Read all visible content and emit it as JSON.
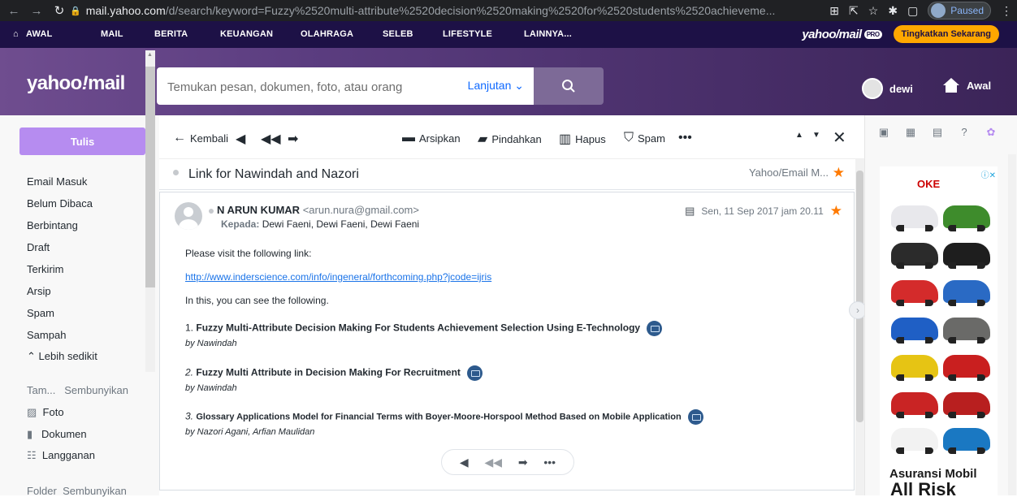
{
  "browser": {
    "url_host": "mail.yahoo.com",
    "url_path": "/d/search/keyword=Fuzzy%2520multi-attribute%2520decision%2520making%2520for%2520students%2520achieveme...",
    "paused_label": "Paused"
  },
  "topnav": {
    "items": [
      "AWAL",
      "MAIL",
      "BERITA",
      "KEUANGAN",
      "OLAHRAGA",
      "SELEB",
      "LIFESTYLE",
      "LAINNYA..."
    ],
    "logo": "yahoo/mail",
    "pro": "PRO",
    "upgrade_label": "Tingkatkan Sekarang"
  },
  "header": {
    "logo_text": "yahoo",
    "logo_bang": "!",
    "logo_mail": "mail",
    "search_placeholder": "Temukan pesan, dokumen, foto, atau orang",
    "advanced_label": "Lanjutan",
    "user_name": "dewi",
    "home_label": "Awal"
  },
  "sidebar": {
    "compose_label": "Tulis",
    "folders": [
      "Email Masuk",
      "Belum Dibaca",
      "Berbintang",
      "Draft",
      "Terkirim",
      "Arsip",
      "Spam",
      "Sampah"
    ],
    "less_label": "Lebih sedikit",
    "views_label": "Tam...",
    "views_hide": "Sembunyikan",
    "views": [
      "Foto",
      "Dokumen",
      "Langganan"
    ],
    "folders_label": "Folder",
    "folders_hide": "Sembunyikan"
  },
  "toolbar": {
    "back": "Kembali",
    "archive": "Arsipkan",
    "move": "Pindahkan",
    "delete": "Hapus",
    "spam": "Spam"
  },
  "email": {
    "subject": "Link for Nawindah and Nazori",
    "folder_label": "Yahoo/Email M...",
    "sender_name": "N ARUN KUMAR",
    "sender_email": "<arun.nura@gmail.com>",
    "to_label": "Kepada:",
    "recipients": "Dewi Faeni,  Dewi Faeni,  Dewi Faeni",
    "date": "Sen, 11 Sep 2017 jam 20.11",
    "line1": "Please visit the following link:",
    "link": "http://www.inderscience.com/info/ingeneral/forthcoming.php?jcode=ijris",
    "line2": "In this, you can see the following.",
    "items": [
      {
        "num": "1.",
        "title": "Fuzzy Multi-Attribute Decision Making For Students Achievement Selection Using E-Technology",
        "by": "by Nawindah"
      },
      {
        "num": "2.",
        "title": "Fuzzy Multi Attribute in Decision Making For Recruitment",
        "by": "by Nawindah"
      },
      {
        "num": "3.",
        "title": "Glossary Applications Model for Financial Terms with Boyer-Moore-Horspool Method Based on Mobile Application",
        "by": "by Nazori Agani, Arfian Maulidan"
      }
    ]
  },
  "ad": {
    "brand": "OKE",
    "line1": "Asuransi Mobil",
    "line2": "All Risk"
  },
  "colors": {
    "nav_bg": "#1d1146",
    "compose": "#b68cf0",
    "star": "#ff7a00",
    "upgrade": "#ffa700",
    "link": "#1a73e8"
  }
}
